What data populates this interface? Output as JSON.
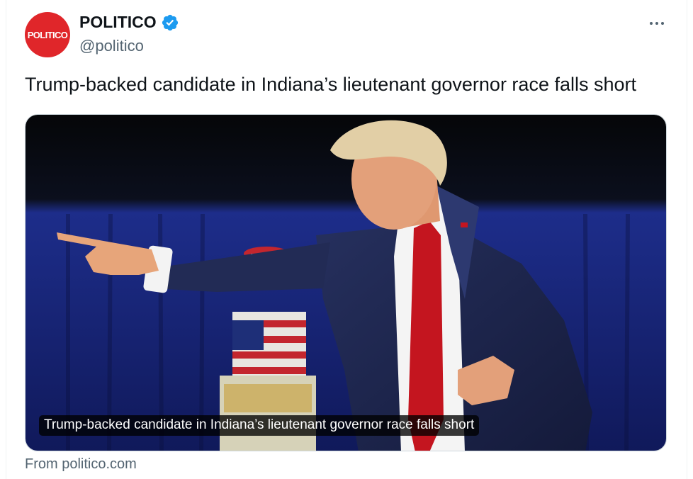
{
  "account": {
    "avatar_text": "POLITICO",
    "display_name": "POLITICO",
    "handle": "@politico",
    "verified_icon": "verified-badge-icon",
    "avatar_color": "#e0262a",
    "verified_color": "#1d9bf0"
  },
  "menu": {
    "icon": "more-horizontal-icon"
  },
  "tweet": {
    "text": "Trump-backed candidate in Indiana’s lieutenant governor race falls short"
  },
  "card": {
    "caption": "Trump-backed candidate in Indiana’s lieutenant governor race falls short",
    "source": "From politico.com",
    "image_subject": "photo"
  }
}
